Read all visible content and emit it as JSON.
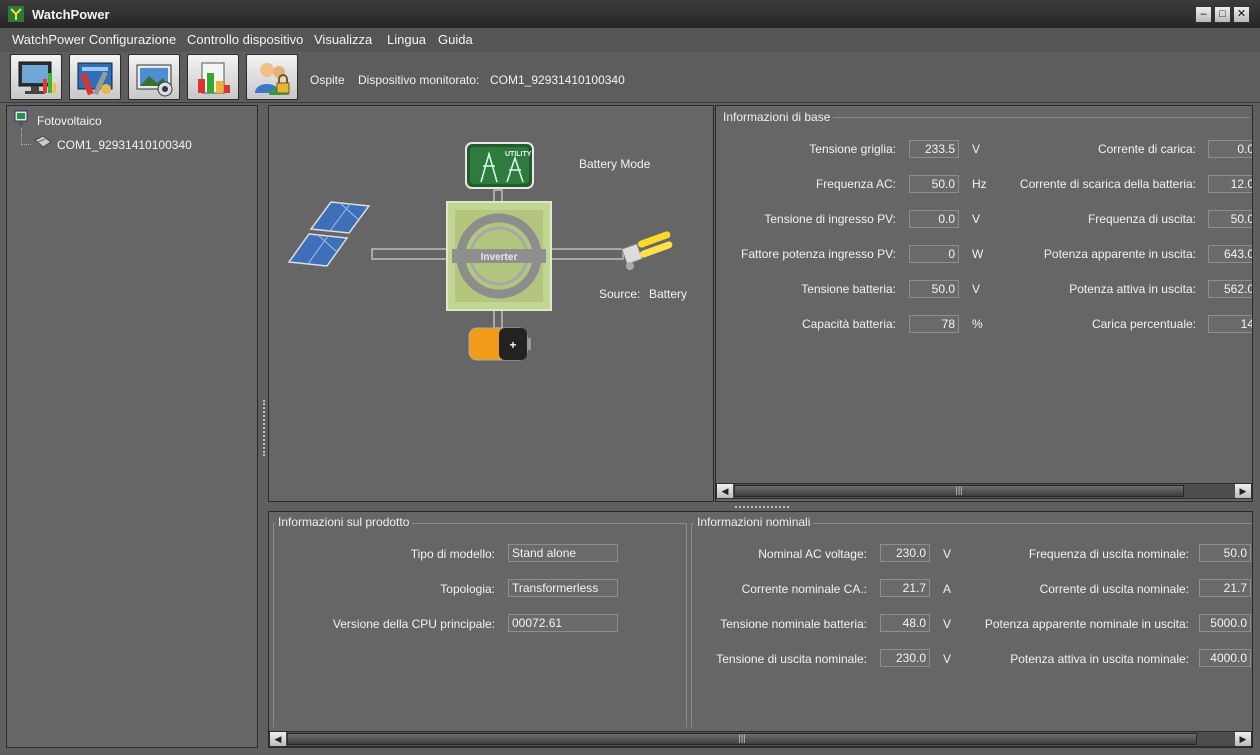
{
  "window": {
    "title": "WatchPower",
    "colors": {
      "background": "#5f5f5f",
      "panel": "#666666"
    }
  },
  "menu": [
    {
      "label": "WatchPower Configurazione"
    },
    {
      "label": "Controllo dispositivo"
    },
    {
      "label": "Visualizza"
    },
    {
      "label": "Lingua"
    },
    {
      "label": "Guida"
    }
  ],
  "toolbar": {
    "buttons": [
      {
        "icon": "monitor-chart-icon"
      },
      {
        "icon": "configuration-tools-icon"
      },
      {
        "icon": "camera-screen-icon"
      },
      {
        "icon": "data-report-icon"
      },
      {
        "icon": "users-lock-icon"
      }
    ],
    "user": "Ospite",
    "monitored_label": "Dispositivo monitorato:",
    "monitored_device": "COM1_92931410100340"
  },
  "tree": {
    "root": "Fotovoltaico",
    "device": "COM1_92931410100340"
  },
  "diagram": {
    "mode": "Battery Mode",
    "source_label": "Source:",
    "source_value": "Battery",
    "inverter_label": "Inverter",
    "utility_label": "UTILITY",
    "battery_symbol": "+"
  },
  "basic_info": {
    "title": "Informazioni di base",
    "left": [
      {
        "label": "Tensione griglia:",
        "value": "233.5",
        "unit": "V"
      },
      {
        "label": "Frequenza AC:",
        "value": "50.0",
        "unit": "Hz"
      },
      {
        "label": "Tensione di ingresso PV:",
        "value": "0.0",
        "unit": "V"
      },
      {
        "label": "Fattore potenza ingresso PV:",
        "value": "0",
        "unit": "W"
      },
      {
        "label": "Tensione batteria:",
        "value": "50.0",
        "unit": "V"
      },
      {
        "label": "Capacità batteria:",
        "value": "78",
        "unit": "%"
      }
    ],
    "right": [
      {
        "label": "Corrente di carica:",
        "value": "0.0"
      },
      {
        "label": "Corrente di scarica della batteria:",
        "value": "12.0"
      },
      {
        "label": "Frequenza di uscita:",
        "value": "50.0"
      },
      {
        "label": "Potenza apparente in uscita:",
        "value": "643.0"
      },
      {
        "label": "Potenza attiva in uscita:",
        "value": "562.0"
      },
      {
        "label": "Carica percentuale:",
        "value": "14"
      }
    ]
  },
  "product_info": {
    "title": "Informazioni sul prodotto",
    "rows": [
      {
        "label": "Tipo di modello:",
        "value": "Stand alone"
      },
      {
        "label": "Topologia:",
        "value": "Transformerless"
      },
      {
        "label": "Versione della CPU principale:",
        "value": "00072.61"
      }
    ]
  },
  "nominal_info": {
    "title": "Informazioni nominali",
    "left": [
      {
        "label": "Nominal AC voltage:",
        "value": "230.0",
        "unit": "V"
      },
      {
        "label": "Corrente nominale CA.:",
        "value": "21.7",
        "unit": "A"
      },
      {
        "label": "Tensione nominale batteria:",
        "value": "48.0",
        "unit": "V"
      },
      {
        "label": "Tensione di uscita nominale:",
        "value": "230.0",
        "unit": "V"
      }
    ],
    "right": [
      {
        "label": "Frequenza di uscita nominale:",
        "value": "50.0"
      },
      {
        "label": "Corrente di uscita nominale:",
        "value": "21.7"
      },
      {
        "label": "Potenza apparente nominale in uscita:",
        "value": "5000.0"
      },
      {
        "label": "Potenza attiva in uscita nominale:",
        "value": "4000.0"
      }
    ]
  }
}
